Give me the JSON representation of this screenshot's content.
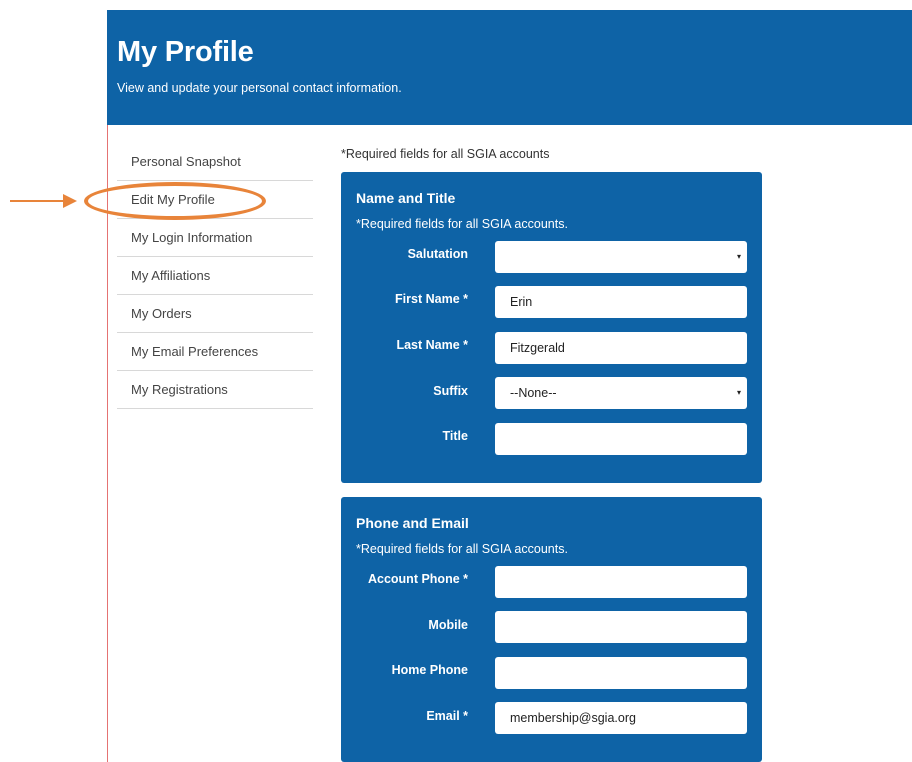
{
  "header": {
    "title": "My Profile",
    "subtitle": "View and update your personal contact information."
  },
  "sidebar": {
    "items": [
      {
        "label": "Personal Snapshot"
      },
      {
        "label": "Edit My Profile"
      },
      {
        "label": "My Login Information"
      },
      {
        "label": "My Affiliations"
      },
      {
        "label": "My Orders"
      },
      {
        "label": "My Email Preferences"
      },
      {
        "label": "My Registrations"
      }
    ],
    "selected": "Edit My Profile"
  },
  "annotation": {
    "color": "#e8843a",
    "icon": "arrow-right-icon"
  },
  "form": {
    "required_note": "*Required fields for all SGIA accounts",
    "name_panel": {
      "title": "Name and Title",
      "required_note": "*Required fields for all SGIA accounts.",
      "fields": {
        "salutation": {
          "label": "Salutation",
          "value": ""
        },
        "first_name": {
          "label": "First Name *",
          "value": "Erin"
        },
        "last_name": {
          "label": "Last Name *",
          "value": "Fitzgerald"
        },
        "suffix": {
          "label": "Suffix",
          "value": "--None--"
        },
        "title": {
          "label": "Title",
          "value": ""
        }
      }
    },
    "phone_panel": {
      "title": "Phone and Email",
      "required_note": "*Required fields for all SGIA accounts.",
      "fields": {
        "account_phone": {
          "label": "Account Phone *",
          "value": ""
        },
        "mobile": {
          "label": "Mobile",
          "value": ""
        },
        "home_phone": {
          "label": "Home Phone",
          "value": ""
        },
        "email": {
          "label": "Email *",
          "value": "membership@sgia.org"
        }
      }
    },
    "caret": "▾"
  },
  "colors": {
    "brand_blue": "#0e63a6",
    "annotation_orange": "#e8843a"
  }
}
